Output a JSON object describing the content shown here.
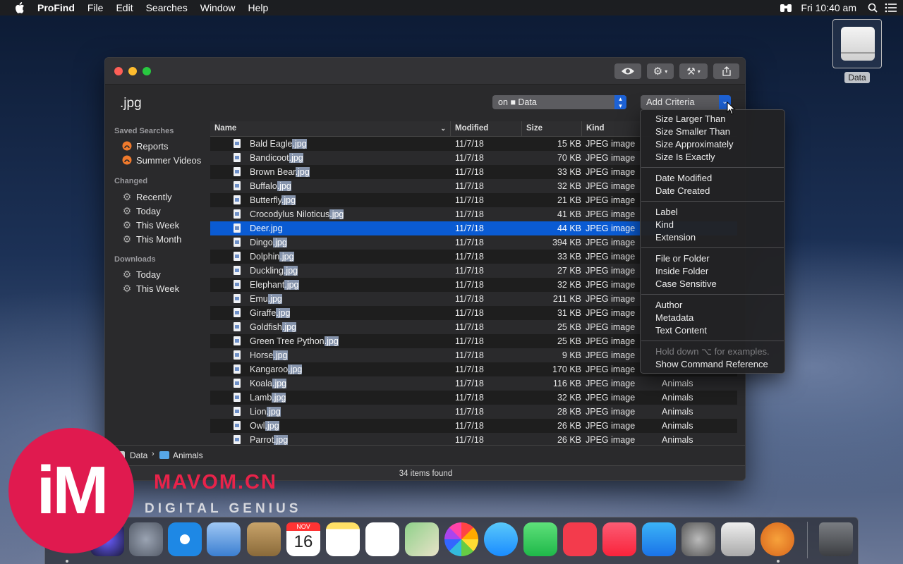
{
  "menubar": {
    "apple_icon": "apple-icon",
    "app_name": "ProFind",
    "menus": [
      "File",
      "Edit",
      "Searches",
      "Window",
      "Help"
    ],
    "clock": "Fri 10:40 am"
  },
  "desktop": {
    "drive_label": "Data"
  },
  "window": {
    "query": ".jpg",
    "scope_label": "on ■ Data",
    "add_criteria_label": "Add Criteria",
    "toolbar_icons": [
      "eye-icon",
      "gear-icon",
      "tools-icon",
      "share-icon"
    ]
  },
  "sidebar": {
    "saved_heading": "Saved Searches",
    "saved": [
      "Reports",
      "Summer Videos"
    ],
    "changed_heading": "Changed",
    "changed": [
      "Recently",
      "Today",
      "This Week",
      "This Month"
    ],
    "downloads_heading": "Downloads",
    "downloads": [
      "Today",
      "This Week"
    ]
  },
  "table": {
    "columns": [
      "Name",
      "Modified",
      "Size",
      "Kind"
    ],
    "highlight_suffix": ".jpg",
    "selected_index": 6,
    "rows": [
      {
        "base": "Bald Eagle",
        "modified": "11/7/18",
        "size": "15 KB",
        "kind": "JPEG image",
        "folder": ""
      },
      {
        "base": "Bandicoot",
        "modified": "11/7/18",
        "size": "70 KB",
        "kind": "JPEG image",
        "folder": ""
      },
      {
        "base": "Brown Bear",
        "modified": "11/7/18",
        "size": "33 KB",
        "kind": "JPEG image",
        "folder": ""
      },
      {
        "base": "Buffalo",
        "modified": "11/7/18",
        "size": "32 KB",
        "kind": "JPEG image",
        "folder": ""
      },
      {
        "base": "Butterfly",
        "modified": "11/7/18",
        "size": "21 KB",
        "kind": "JPEG image",
        "folder": ""
      },
      {
        "base": "Crocodylus Niloticus",
        "modified": "11/7/18",
        "size": "41 KB",
        "kind": "JPEG image",
        "folder": ""
      },
      {
        "base": "Deer",
        "modified": "11/7/18",
        "size": "44 KB",
        "kind": "JPEG image",
        "folder": ""
      },
      {
        "base": "Dingo",
        "modified": "11/7/18",
        "size": "394 KB",
        "kind": "JPEG image",
        "folder": ""
      },
      {
        "base": "Dolphin",
        "modified": "11/7/18",
        "size": "33 KB",
        "kind": "JPEG image",
        "folder": ""
      },
      {
        "base": "Duckling",
        "modified": "11/7/18",
        "size": "27 KB",
        "kind": "JPEG image",
        "folder": ""
      },
      {
        "base": "Elephant",
        "modified": "11/7/18",
        "size": "32 KB",
        "kind": "JPEG image",
        "folder": ""
      },
      {
        "base": "Emu",
        "modified": "11/7/18",
        "size": "211 KB",
        "kind": "JPEG image",
        "folder": ""
      },
      {
        "base": "Giraffe",
        "modified": "11/7/18",
        "size": "31 KB",
        "kind": "JPEG image",
        "folder": ""
      },
      {
        "base": "Goldfish",
        "modified": "11/7/18",
        "size": "25 KB",
        "kind": "JPEG image",
        "folder": ""
      },
      {
        "base": "Green Tree Python",
        "modified": "11/7/18",
        "size": "25 KB",
        "kind": "JPEG image",
        "folder": ""
      },
      {
        "base": "Horse",
        "modified": "11/7/18",
        "size": "9 KB",
        "kind": "JPEG image",
        "folder": ""
      },
      {
        "base": "Kangaroo",
        "modified": "11/7/18",
        "size": "170 KB",
        "kind": "JPEG image",
        "folder": ""
      },
      {
        "base": "Koala",
        "modified": "11/7/18",
        "size": "116 KB",
        "kind": "JPEG image",
        "folder": "Animals"
      },
      {
        "base": "Lamb",
        "modified": "11/7/18",
        "size": "32 KB",
        "kind": "JPEG image",
        "folder": "Animals"
      },
      {
        "base": "Lion",
        "modified": "11/7/18",
        "size": "28 KB",
        "kind": "JPEG image",
        "folder": "Animals"
      },
      {
        "base": "Owl",
        "modified": "11/7/18",
        "size": "26 KB",
        "kind": "JPEG image",
        "folder": "Animals"
      },
      {
        "base": "Parrot",
        "modified": "11/7/18",
        "size": "26 KB",
        "kind": "JPEG image",
        "folder": "Animals"
      }
    ]
  },
  "pathbar": {
    "items": [
      "Data",
      "Animals"
    ]
  },
  "status": "34 items found",
  "criteria_menu": {
    "groups": [
      [
        "Size Larger Than",
        "Size Smaller Than",
        "Size Approximately",
        "Size Is Exactly"
      ],
      [
        "Date Modified",
        "Date Created"
      ],
      [
        "Label",
        "Kind",
        "Extension"
      ],
      [
        "File or Folder",
        "Inside Folder",
        "Case Sensitive"
      ],
      [
        "Author",
        "Metadata",
        "Text Content"
      ]
    ],
    "hint": "Hold down ⌥ for examples.",
    "last": "Show Command Reference"
  },
  "watermark": {
    "logo": "iM",
    "brand": "MAVOM.CN",
    "tagline": "DIGITAL GENIUS"
  },
  "dock": {
    "apps": [
      "Siri",
      "Launchpad",
      "Safari",
      "Mail",
      "Contacts",
      "Calendar",
      "Notes",
      "Reminders",
      "Maps",
      "Photos",
      "Messages",
      "FaceTime",
      "News",
      "Music",
      "App Store",
      "System Preferences",
      "Screenshot",
      "ProFind",
      "Trash"
    ],
    "calendar_month": "NOV",
    "calendar_day": "16"
  },
  "colors": {
    "accent": "#0a5bd3",
    "highlight": "#8593ab",
    "watermark_red": "#e01a4f"
  }
}
